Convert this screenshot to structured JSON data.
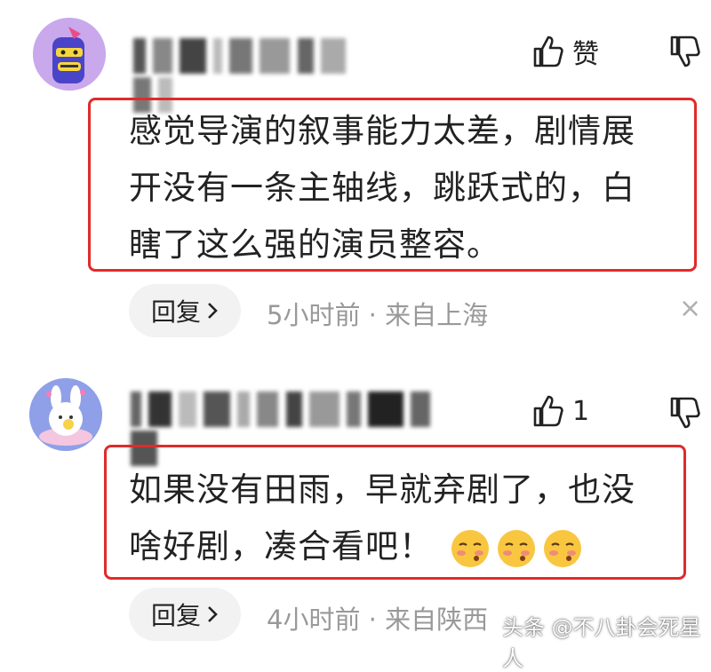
{
  "comments": [
    {
      "likes_label": "赞",
      "text_lines": [
        "感觉导演的叙事能力太差，剧情展",
        "开没有一条主轴线，跳跃式的，白",
        "瞎了这么强的演员整容。"
      ],
      "reply_label": "回复",
      "meta": "5小时前 · 来自上海",
      "close": "×"
    },
    {
      "likes_label": "1",
      "text_lines": [
        "如果没有田雨，早就弃剧了，也没",
        "啥好剧，凑合看吧！"
      ],
      "reply_label": "回复",
      "meta": "4小时前 · 来自陕西",
      "close": "×"
    }
  ],
  "watermark": "头条 @不八卦会死星人",
  "colors": {
    "highlight_border": "#e02b2b",
    "meta_text": "#999999"
  },
  "icons": [
    "thumbs-up-icon",
    "thumbs-down-icon",
    "chevron-right-icon",
    "close-icon",
    "blush-emoji-icon"
  ]
}
